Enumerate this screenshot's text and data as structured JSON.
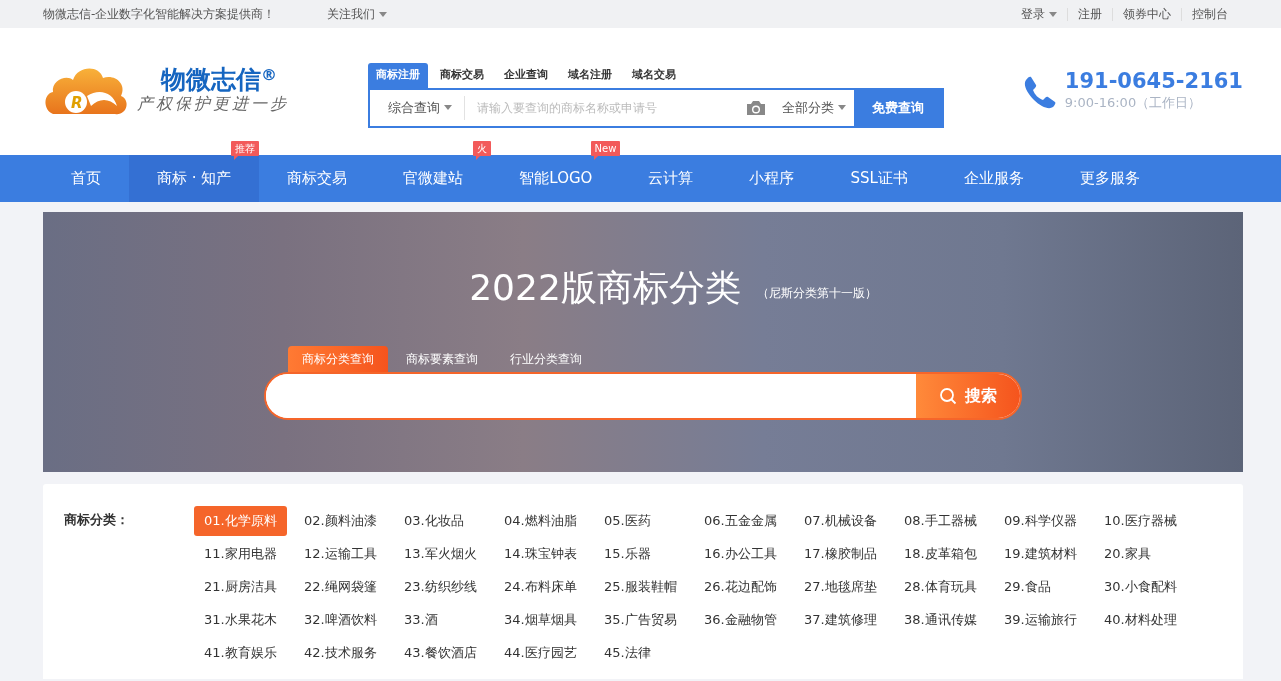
{
  "top_bar": {
    "slogan": "物微志信-企业数字化智能解决方案提供商！",
    "follow_menu": "关注我们",
    "links": [
      {
        "label": "登录",
        "dropdown": true
      },
      {
        "label": "注册",
        "dropdown": false
      },
      {
        "label": "领券中心",
        "dropdown": false
      },
      {
        "label": "控制台",
        "dropdown": false
      }
    ]
  },
  "header": {
    "logo": {
      "emblem_letter": "R",
      "name": "物微志信",
      "mark": "®",
      "tagline": "产权保护更进一步"
    },
    "search_tabs": [
      {
        "label": "商标注册",
        "selected": true
      },
      {
        "label": "商标交易",
        "selected": false
      },
      {
        "label": "企业查询",
        "selected": false
      },
      {
        "label": "域名注册",
        "selected": false
      },
      {
        "label": "域名交易",
        "selected": false
      }
    ],
    "search": {
      "scope": "综合查询",
      "placeholder": "请输入要查询的商标名称或申请号",
      "category": "全部分类",
      "button": "免费查询"
    },
    "hotline": {
      "number": "191-0645-2161",
      "hours": "9:00-16:00（工作日）"
    }
  },
  "nav": {
    "items": [
      {
        "label": "首页",
        "selected": false
      },
      {
        "label": "商标 · 知产",
        "selected": true,
        "tag": "推荐"
      },
      {
        "label": "商标交易",
        "selected": false
      },
      {
        "label": "官微建站",
        "selected": false,
        "tag": "火"
      },
      {
        "label": "智能LOGO",
        "selected": false,
        "tag": "New"
      },
      {
        "label": "云计算",
        "selected": false
      },
      {
        "label": "小程序",
        "selected": false
      },
      {
        "label": "SSL证书",
        "selected": false
      },
      {
        "label": "企业服务",
        "selected": false
      },
      {
        "label": "更多服务",
        "selected": false
      }
    ]
  },
  "banner": {
    "title": "2022版商标分类",
    "subtitle": "（尼斯分类第十一版）",
    "tabs": [
      {
        "label": "商标分类查询",
        "selected": true
      },
      {
        "label": "商标要素查询",
        "selected": false
      },
      {
        "label": "行业分类查询",
        "selected": false
      }
    ],
    "search_button": "搜索"
  },
  "classes": {
    "label": "商标分类：",
    "items": [
      {
        "label": "01.化学原料",
        "selected": true
      },
      {
        "label": "02.颜料油漆",
        "selected": false
      },
      {
        "label": "03.化妆品",
        "selected": false
      },
      {
        "label": "04.燃料油脂",
        "selected": false
      },
      {
        "label": "05.医药",
        "selected": false
      },
      {
        "label": "06.五金金属",
        "selected": false
      },
      {
        "label": "07.机械设备",
        "selected": false
      },
      {
        "label": "08.手工器械",
        "selected": false
      },
      {
        "label": "09.科学仪器",
        "selected": false
      },
      {
        "label": "10.医疗器械",
        "selected": false
      },
      {
        "label": "11.家用电器",
        "selected": false
      },
      {
        "label": "12.运输工具",
        "selected": false
      },
      {
        "label": "13.军火烟火",
        "selected": false
      },
      {
        "label": "14.珠宝钟表",
        "selected": false
      },
      {
        "label": "15.乐器",
        "selected": false
      },
      {
        "label": "16.办公工具",
        "selected": false
      },
      {
        "label": "17.橡胶制品",
        "selected": false
      },
      {
        "label": "18.皮革箱包",
        "selected": false
      },
      {
        "label": "19.建筑材料",
        "selected": false
      },
      {
        "label": "20.家具",
        "selected": false
      },
      {
        "label": "21.厨房洁具",
        "selected": false
      },
      {
        "label": "22.绳网袋篷",
        "selected": false
      },
      {
        "label": "23.纺织纱线",
        "selected": false
      },
      {
        "label": "24.布料床单",
        "selected": false
      },
      {
        "label": "25.服装鞋帽",
        "selected": false
      },
      {
        "label": "26.花边配饰",
        "selected": false
      },
      {
        "label": "27.地毯席垫",
        "selected": false
      },
      {
        "label": "28.体育玩具",
        "selected": false
      },
      {
        "label": "29.食品",
        "selected": false
      },
      {
        "label": "30.小食配料",
        "selected": false
      },
      {
        "label": "31.水果花木",
        "selected": false
      },
      {
        "label": "32.啤酒饮料",
        "selected": false
      },
      {
        "label": "33.酒",
        "selected": false
      },
      {
        "label": "34.烟草烟具",
        "selected": false
      },
      {
        "label": "35.广告贸易",
        "selected": false
      },
      {
        "label": "36.金融物管",
        "selected": false
      },
      {
        "label": "37.建筑修理",
        "selected": false
      },
      {
        "label": "38.通讯传媒",
        "selected": false
      },
      {
        "label": "39.运输旅行",
        "selected": false
      },
      {
        "label": "40.材料处理",
        "selected": false
      },
      {
        "label": "41.教育娱乐",
        "selected": false
      },
      {
        "label": "42.技术服务",
        "selected": false
      },
      {
        "label": "43.餐饮酒店",
        "selected": false
      },
      {
        "label": "44.医疗园艺",
        "selected": false
      },
      {
        "label": "45.法律",
        "selected": false
      }
    ]
  }
}
